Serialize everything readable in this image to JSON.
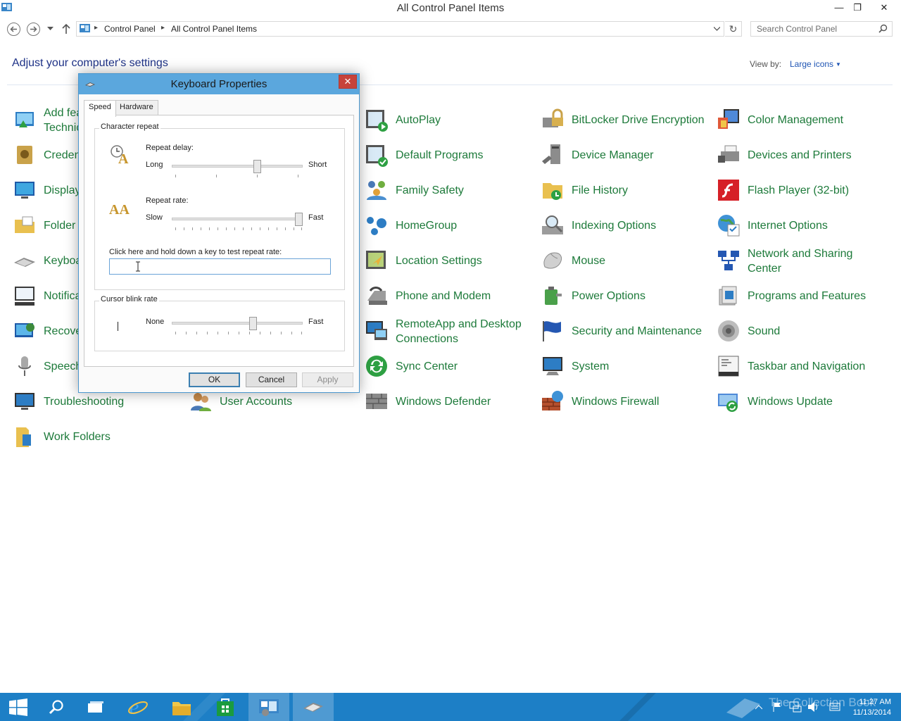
{
  "window": {
    "title": "All Control Panel Items"
  },
  "address_bar": {
    "crumbs": [
      "Control Panel",
      "All Control Panel Items"
    ],
    "search_placeholder": "Search Control Panel"
  },
  "header": {
    "heading": "Adjust your computer's settings",
    "view_by_label": "View by:",
    "view_mode": "Large icons"
  },
  "items": [
    {
      "label": "Add fea Technic"
    },
    {
      "label": "AutoPlay",
      "icon": "autoplay-icon"
    },
    {
      "label": "BitLocker Drive Encryption",
      "icon": "bitlocker-icon"
    },
    {
      "label": "Color Management",
      "icon": "color-management-icon"
    },
    {
      "label": "Creden"
    },
    {
      "label": "Default Programs",
      "icon": "default-programs-icon"
    },
    {
      "label": "Device Manager",
      "icon": "device-manager-icon"
    },
    {
      "label": "Devices and Printers",
      "icon": "printer-icon"
    },
    {
      "label": "Display"
    },
    {
      "label": "Family Safety",
      "icon": "family-icon"
    },
    {
      "label": "File History",
      "icon": "file-history-icon"
    },
    {
      "label": "Flash Player (32-bit)",
      "icon": "flash-icon"
    },
    {
      "label": "Folder"
    },
    {
      "label": "HomeGroup",
      "icon": "homegroup-icon"
    },
    {
      "label": "Indexing Options",
      "icon": "indexing-icon"
    },
    {
      "label": "Internet Options",
      "icon": "globe-icon"
    },
    {
      "label": "Keyboa"
    },
    {
      "label": "Location Settings",
      "icon": "location-icon"
    },
    {
      "label": "Mouse",
      "icon": "mouse-icon"
    },
    {
      "label": "Network and Sharing Center",
      "icon": "network-icon"
    },
    {
      "label": "Notifica"
    },
    {
      "label": "Phone and Modem",
      "icon": "phone-icon"
    },
    {
      "label": "Power Options",
      "icon": "power-icon"
    },
    {
      "label": "Programs and Features",
      "icon": "programs-icon"
    },
    {
      "label": "Recove"
    },
    {
      "label": "RemoteApp and Desktop Connections",
      "icon": "remoteapp-icon"
    },
    {
      "label": "Security and Maintenance",
      "icon": "flag-icon"
    },
    {
      "label": "Sound",
      "icon": "speaker-icon"
    },
    {
      "label": "Speech"
    },
    {
      "label": "Sync Center",
      "icon": "sync-icon"
    },
    {
      "label": "System",
      "icon": "system-icon"
    },
    {
      "label": "Taskbar and Navigation",
      "icon": "taskbar-icon"
    },
    {
      "label": "Troubleshooting",
      "icon": "troubleshooting-icon"
    },
    {
      "label": "User Accounts",
      "icon": "users-icon"
    },
    {
      "label": "Windows Defender",
      "icon": "defender-icon"
    },
    {
      "label": "Windows Firewall",
      "icon": "firewall-icon"
    },
    {
      "label": "Windows Update",
      "icon": "update-icon"
    },
    {
      "label": "Work Folders",
      "icon": "work-folders-icon"
    }
  ],
  "dialog": {
    "title": "Keyboard Properties",
    "tabs": [
      "Speed",
      "Hardware"
    ],
    "character_repeat": {
      "group_label": "Character repeat",
      "delay_label": "Repeat delay:",
      "delay_min": "Long",
      "delay_max": "Short",
      "delay_value": 0.66,
      "rate_label": "Repeat rate:",
      "rate_min": "Slow",
      "rate_max": "Fast",
      "rate_value": 1.0,
      "test_label": "Click here and hold down a key to test repeat rate:"
    },
    "cursor_blink": {
      "group_label": "Cursor blink rate",
      "min": "None",
      "max": "Fast",
      "value": 0.63
    },
    "buttons": {
      "ok": "OK",
      "cancel": "Cancel",
      "apply": "Apply"
    }
  },
  "taskbar": {
    "time": "11:27 AM",
    "date": "11/13/2014",
    "watermark": "The Collection Book"
  },
  "colors": {
    "item_text": "#1d7a3a",
    "heading": "#1e3287",
    "dialog_title_bar": "#5ba7dd",
    "taskbar": "#1d7fc6"
  }
}
